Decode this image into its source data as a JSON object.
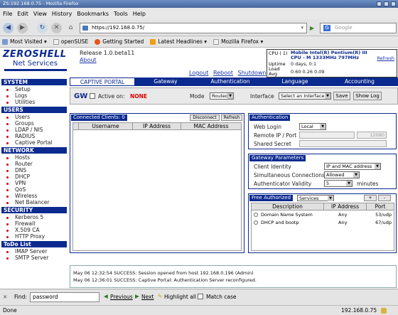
{
  "window": {
    "title": "ZS:192.168.0.75 - Mozilla Firefox"
  },
  "menu": [
    "File",
    "Edit",
    "View",
    "History",
    "Bookmarks",
    "Tools",
    "Help"
  ],
  "nav": {
    "url": "https://192.168.0.75/",
    "search_placeholder": "Google"
  },
  "bookmarks": [
    "Most Visited",
    "openSUSE",
    "Getting Started",
    "Latest Headlines",
    "Mozilla Firefox"
  ],
  "header": {
    "logo_top": "ZEROSHELL",
    "logo_bottom": "Net Services",
    "release": "Release 1.0.beta11",
    "about": "About",
    "links": [
      "Logout",
      "Reboot",
      "Shutdown"
    ]
  },
  "cpu": {
    "cpu_label": "CPU ( 1)",
    "cpu_value": "Mobile Intel(R) Pentium(R) III CPU - M 1333MHz 797MHz",
    "uptime_label": "Uptime",
    "uptime_value": "0 days, 0:1",
    "load_label": "Load Avg",
    "load_value": "0.60 0.26 0.09",
    "refresh": "Refresh"
  },
  "sidebar": {
    "sections": [
      {
        "title": "SYSTEM",
        "items": [
          "Setup",
          "Logs",
          "Utilities"
        ]
      },
      {
        "title": "USERS",
        "items": [
          "Users",
          "Groups",
          "LDAP / NIS",
          "RADIUS",
          "Captive Portal"
        ]
      },
      {
        "title": "NETWORK",
        "items": [
          "Hosts",
          "Router",
          "DNS",
          "DHCP",
          "VPN",
          "QoS",
          "Wireless",
          "Net Balancer"
        ]
      },
      {
        "title": "SECURITY",
        "items": [
          "Kerberos 5",
          "Firewall",
          "X.509 CA",
          "HTTP Proxy"
        ]
      },
      {
        "title": "ToDo List",
        "items": [
          "IMAP Server",
          "SMTP Server"
        ]
      }
    ]
  },
  "tabs": [
    "CAPTIVE PORTAL",
    "Gateway",
    "Authentication",
    "Language",
    "Accounting"
  ],
  "gw": {
    "label": "GW",
    "active_label": "Active on:",
    "active_value": "NONE",
    "mode_label": "Mode",
    "mode_value": "Routed",
    "interface_label": "Interface",
    "interface_value": "Select an Interface",
    "save": "Save",
    "showlog": "Show Log"
  },
  "clients": {
    "title": "Connected Clients:  0",
    "disconnect": "Disconnect",
    "refresh": "Refresh",
    "columns": [
      "Username",
      "IP Address",
      "MAC Address"
    ]
  },
  "auth": {
    "title": "Authentication",
    "web_login_label": "Web Login",
    "web_login_value": "Local",
    "remote_label": "Remote IP / Port",
    "port_value": "12080",
    "secret_label": "Shared Secret"
  },
  "gateway": {
    "title": "Gateway Parameters",
    "client_identity_label": "Client Identity",
    "client_identity_value": "IP and MAC address",
    "simultaneous_label": "Simultaneous Connections",
    "simultaneous_value": "Allowed",
    "validity_label": "Authenticator Validity",
    "validity_value": "5",
    "validity_unit": "minutes"
  },
  "free": {
    "title": "Free Authorized",
    "select_value": "Services",
    "add": "+",
    "remove": "-",
    "columns": [
      "Description",
      "IP Address",
      "Port"
    ],
    "rows": [
      {
        "desc": "Domain Name System",
        "ip": "Any",
        "port": "53/udp"
      },
      {
        "desc": "DHCP and bootp",
        "ip": "Any",
        "port": "67/udp"
      }
    ]
  },
  "log": [
    "May 06 12:32:54 SUCCESS: Session opened from host 192.168.0.196 (Admin)",
    "May 06 12:36:01 SUCCESS: Captive Portal: Authentication Server reconfigured."
  ],
  "find": {
    "label": "Find:",
    "value": "password",
    "previous": "Previous",
    "next": "Next",
    "highlight": "Highlight all",
    "match_case": "Match case"
  },
  "status": {
    "left": "Done",
    "right": "192.168.0.75"
  }
}
